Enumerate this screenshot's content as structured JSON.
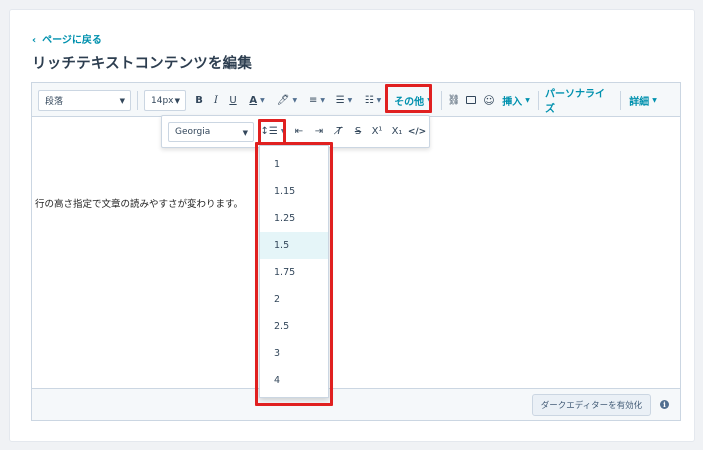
{
  "nav": {
    "back_label": "ページに戻る"
  },
  "page": {
    "title": "リッチテキストコンテンツを編集"
  },
  "toolbar": {
    "block_format": "段落",
    "font_size": "14px",
    "bold": "B",
    "italic": "I",
    "underline": "U",
    "font_color": "A",
    "more_label": "その他",
    "insert_label": "挿入",
    "personalize_label": "パーソナライズ",
    "advanced_label": "詳細"
  },
  "sub_toolbar": {
    "font_family": "Georgia",
    "superscript": "X¹",
    "subscript": "X₁"
  },
  "line_height_menu": {
    "options": [
      "1",
      "1.15",
      "1.25",
      "1.5",
      "1.75",
      "2",
      "2.5",
      "3",
      "4"
    ],
    "selected": "1.5"
  },
  "editor": {
    "body_text": "行の高さ指定で文章の読みやすさが変わります。"
  },
  "footer": {
    "dark_editor_button": "ダークエディターを有効化",
    "info_icon": "i"
  },
  "colors": {
    "accent": "#0091ae",
    "highlight": "#e02020",
    "selected_bg": "#e5f5f8"
  }
}
